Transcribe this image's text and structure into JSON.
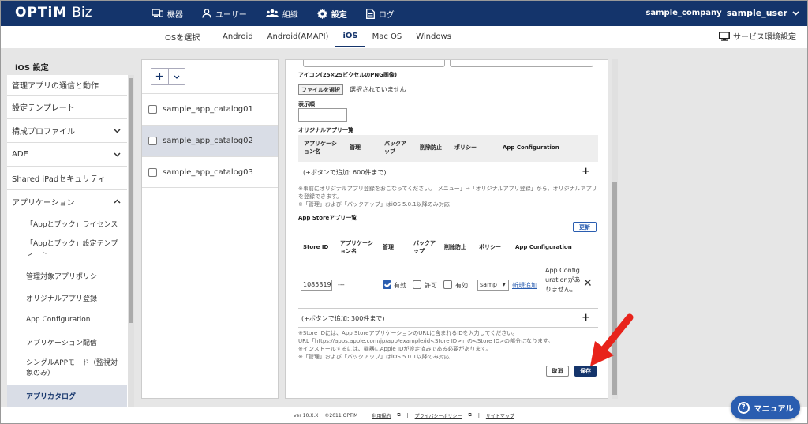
{
  "header": {
    "logo_main": "OPTiM",
    "logo_sub": "Biz",
    "nav": [
      {
        "label": "機器",
        "icon": "device-icon"
      },
      {
        "label": "ユーザー",
        "icon": "user-icon"
      },
      {
        "label": "組織",
        "icon": "group-icon"
      },
      {
        "label": "設定",
        "icon": "gear-icon"
      },
      {
        "label": "ログ",
        "icon": "log-icon"
      }
    ],
    "company": "sample_company",
    "user": "sample_user",
    "colors": {
      "brand": "#14346b",
      "accent": "#2a5db0",
      "arrow": "#e8231b"
    }
  },
  "tabbar": {
    "os_select": "OSを選択",
    "tabs": [
      "Android",
      "Android(AMAPI)",
      "iOS",
      "Mac OS",
      "Windows"
    ],
    "active_tab": "iOS",
    "service_env": "サービス環境設定"
  },
  "sidebar": {
    "title": "iOS 設定",
    "items": [
      "管理アプリの通信と動作",
      "設定テンプレート",
      "構成プロファイル",
      "ADE",
      "Shared iPadセキュリティ",
      "アプリケーション",
      "「Appとブック」ライセンス",
      "「Appとブック」設定テンプレート",
      "管理対象アプリポリシー",
      "オリジナルアプリ登録",
      "App Configuration",
      "アプリケーション配信",
      "シングルAPPモード（監視対象のみ）",
      "アプリカタログ"
    ]
  },
  "catalog_list": {
    "items": [
      "sample_app_catalog01",
      "sample_app_catalog02",
      "sample_app_catalog03"
    ],
    "selected": "sample_app_catalog02"
  },
  "detail": {
    "icon_label": "アイコン(25×25ピクセルのPNG画像)",
    "file_button": "ファイルを選択",
    "file_status": "選択されていません",
    "order_label": "表示順",
    "original_label": "オリジナルアプリ一覧",
    "original_headers": [
      "アプリケーション名",
      "管理",
      "バックアップ",
      "削除防止",
      "ポリシー",
      "App Configuration"
    ],
    "original_add": "(+ボタンで追加: 600件まで)",
    "original_notes": [
      "※事前にオリジナルアプリ登録をおこなってください。「メニュー」→「オリジナルアプリ登録」から、オリジナルアプリを登録できます。",
      "※「管理」および「バックアップ」はiOS 5.0.1以降のみ対応"
    ],
    "store_label": "App Storeアプリ一覧",
    "update_button": "更新",
    "store_headers": [
      "Store ID",
      "アプリケーション名",
      "管理",
      "バックアップ",
      "削除防止",
      "ポリシー",
      "App Configuration"
    ],
    "store_row": {
      "store_id": "1085319",
      "app_name": "---",
      "manage_label": "有効",
      "backup_label": "許可",
      "delete_label": "有効",
      "policy": "samp",
      "new_link": "新規追加",
      "config_msg": "App Configurationがありません。"
    },
    "store_add": "(+ボタンで追加: 300件まで)",
    "store_notes": [
      "※Store IDには、App StoreアプリケーションのURLに含まれるIDを入力してください。",
      "URL「https://apps.apple.com/jp/app/example/id<Store ID>」の<Store ID>の部分になります。",
      "※インストールするには、機器にApple IDが設定済みである必要があります。",
      "※「管理」および「バックアップ」はiOS 5.0.1以降のみ対応"
    ],
    "cancel": "取消",
    "save": "保存"
  },
  "footer": {
    "version": "ver 10.X.X",
    "copyright": "©2011 OPTiM",
    "links": [
      "利用規約",
      "プライバシーポリシー",
      "サイトマップ"
    ]
  },
  "manual": "マニュアル"
}
